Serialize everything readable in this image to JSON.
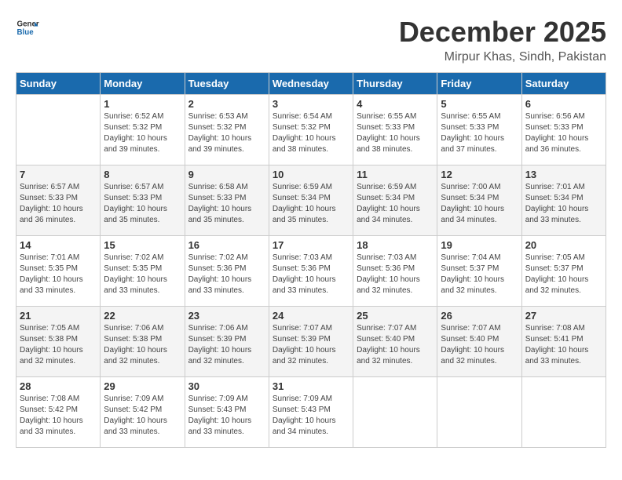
{
  "logo": {
    "line1": "General",
    "line2": "Blue"
  },
  "title": "December 2025",
  "location": "Mirpur Khas, Sindh, Pakistan",
  "headers": [
    "Sunday",
    "Monday",
    "Tuesday",
    "Wednesday",
    "Thursday",
    "Friday",
    "Saturday"
  ],
  "weeks": [
    [
      {
        "day": "",
        "sunrise": "",
        "sunset": "",
        "daylight": ""
      },
      {
        "day": "1",
        "sunrise": "Sunrise: 6:52 AM",
        "sunset": "Sunset: 5:32 PM",
        "daylight": "Daylight: 10 hours and 39 minutes."
      },
      {
        "day": "2",
        "sunrise": "Sunrise: 6:53 AM",
        "sunset": "Sunset: 5:32 PM",
        "daylight": "Daylight: 10 hours and 39 minutes."
      },
      {
        "day": "3",
        "sunrise": "Sunrise: 6:54 AM",
        "sunset": "Sunset: 5:32 PM",
        "daylight": "Daylight: 10 hours and 38 minutes."
      },
      {
        "day": "4",
        "sunrise": "Sunrise: 6:55 AM",
        "sunset": "Sunset: 5:33 PM",
        "daylight": "Daylight: 10 hours and 38 minutes."
      },
      {
        "day": "5",
        "sunrise": "Sunrise: 6:55 AM",
        "sunset": "Sunset: 5:33 PM",
        "daylight": "Daylight: 10 hours and 37 minutes."
      },
      {
        "day": "6",
        "sunrise": "Sunrise: 6:56 AM",
        "sunset": "Sunset: 5:33 PM",
        "daylight": "Daylight: 10 hours and 36 minutes."
      }
    ],
    [
      {
        "day": "7",
        "sunrise": "Sunrise: 6:57 AM",
        "sunset": "Sunset: 5:33 PM",
        "daylight": "Daylight: 10 hours and 36 minutes."
      },
      {
        "day": "8",
        "sunrise": "Sunrise: 6:57 AM",
        "sunset": "Sunset: 5:33 PM",
        "daylight": "Daylight: 10 hours and 35 minutes."
      },
      {
        "day": "9",
        "sunrise": "Sunrise: 6:58 AM",
        "sunset": "Sunset: 5:33 PM",
        "daylight": "Daylight: 10 hours and 35 minutes."
      },
      {
        "day": "10",
        "sunrise": "Sunrise: 6:59 AM",
        "sunset": "Sunset: 5:34 PM",
        "daylight": "Daylight: 10 hours and 35 minutes."
      },
      {
        "day": "11",
        "sunrise": "Sunrise: 6:59 AM",
        "sunset": "Sunset: 5:34 PM",
        "daylight": "Daylight: 10 hours and 34 minutes."
      },
      {
        "day": "12",
        "sunrise": "Sunrise: 7:00 AM",
        "sunset": "Sunset: 5:34 PM",
        "daylight": "Daylight: 10 hours and 34 minutes."
      },
      {
        "day": "13",
        "sunrise": "Sunrise: 7:01 AM",
        "sunset": "Sunset: 5:34 PM",
        "daylight": "Daylight: 10 hours and 33 minutes."
      }
    ],
    [
      {
        "day": "14",
        "sunrise": "Sunrise: 7:01 AM",
        "sunset": "Sunset: 5:35 PM",
        "daylight": "Daylight: 10 hours and 33 minutes."
      },
      {
        "day": "15",
        "sunrise": "Sunrise: 7:02 AM",
        "sunset": "Sunset: 5:35 PM",
        "daylight": "Daylight: 10 hours and 33 minutes."
      },
      {
        "day": "16",
        "sunrise": "Sunrise: 7:02 AM",
        "sunset": "Sunset: 5:36 PM",
        "daylight": "Daylight: 10 hours and 33 minutes."
      },
      {
        "day": "17",
        "sunrise": "Sunrise: 7:03 AM",
        "sunset": "Sunset: 5:36 PM",
        "daylight": "Daylight: 10 hours and 33 minutes."
      },
      {
        "day": "18",
        "sunrise": "Sunrise: 7:03 AM",
        "sunset": "Sunset: 5:36 PM",
        "daylight": "Daylight: 10 hours and 32 minutes."
      },
      {
        "day": "19",
        "sunrise": "Sunrise: 7:04 AM",
        "sunset": "Sunset: 5:37 PM",
        "daylight": "Daylight: 10 hours and 32 minutes."
      },
      {
        "day": "20",
        "sunrise": "Sunrise: 7:05 AM",
        "sunset": "Sunset: 5:37 PM",
        "daylight": "Daylight: 10 hours and 32 minutes."
      }
    ],
    [
      {
        "day": "21",
        "sunrise": "Sunrise: 7:05 AM",
        "sunset": "Sunset: 5:38 PM",
        "daylight": "Daylight: 10 hours and 32 minutes."
      },
      {
        "day": "22",
        "sunrise": "Sunrise: 7:06 AM",
        "sunset": "Sunset: 5:38 PM",
        "daylight": "Daylight: 10 hours and 32 minutes."
      },
      {
        "day": "23",
        "sunrise": "Sunrise: 7:06 AM",
        "sunset": "Sunset: 5:39 PM",
        "daylight": "Daylight: 10 hours and 32 minutes."
      },
      {
        "day": "24",
        "sunrise": "Sunrise: 7:07 AM",
        "sunset": "Sunset: 5:39 PM",
        "daylight": "Daylight: 10 hours and 32 minutes."
      },
      {
        "day": "25",
        "sunrise": "Sunrise: 7:07 AM",
        "sunset": "Sunset: 5:40 PM",
        "daylight": "Daylight: 10 hours and 32 minutes."
      },
      {
        "day": "26",
        "sunrise": "Sunrise: 7:07 AM",
        "sunset": "Sunset: 5:40 PM",
        "daylight": "Daylight: 10 hours and 32 minutes."
      },
      {
        "day": "27",
        "sunrise": "Sunrise: 7:08 AM",
        "sunset": "Sunset: 5:41 PM",
        "daylight": "Daylight: 10 hours and 33 minutes."
      }
    ],
    [
      {
        "day": "28",
        "sunrise": "Sunrise: 7:08 AM",
        "sunset": "Sunset: 5:42 PM",
        "daylight": "Daylight: 10 hours and 33 minutes."
      },
      {
        "day": "29",
        "sunrise": "Sunrise: 7:09 AM",
        "sunset": "Sunset: 5:42 PM",
        "daylight": "Daylight: 10 hours and 33 minutes."
      },
      {
        "day": "30",
        "sunrise": "Sunrise: 7:09 AM",
        "sunset": "Sunset: 5:43 PM",
        "daylight": "Daylight: 10 hours and 33 minutes."
      },
      {
        "day": "31",
        "sunrise": "Sunrise: 7:09 AM",
        "sunset": "Sunset: 5:43 PM",
        "daylight": "Daylight: 10 hours and 34 minutes."
      },
      {
        "day": "",
        "sunrise": "",
        "sunset": "",
        "daylight": ""
      },
      {
        "day": "",
        "sunrise": "",
        "sunset": "",
        "daylight": ""
      },
      {
        "day": "",
        "sunrise": "",
        "sunset": "",
        "daylight": ""
      }
    ]
  ]
}
